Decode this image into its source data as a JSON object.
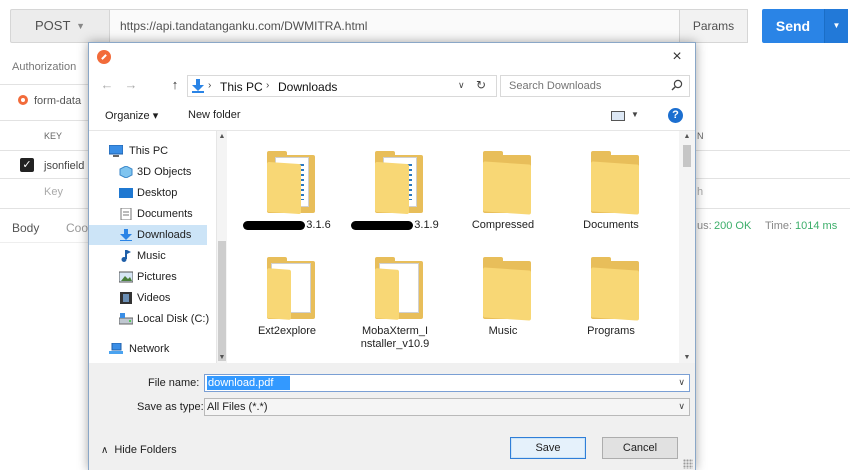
{
  "background_app": {
    "method": "POST",
    "url": "https://api.tandatanganku.com/DWMITRA.html",
    "params_label": "Params",
    "send_label": "Send",
    "section_tab": "Authorization",
    "body_type": "form-data",
    "table_header_key": "KEY",
    "table_header_partial": "N",
    "row_key": "jsonfield",
    "row_key_placeholder": "Key",
    "row_value_partial": "h",
    "response_tab_body": "Body",
    "response_tab_partial": "Coo",
    "status_label": "us:",
    "status_value": "200 OK",
    "time_label": "Time:",
    "time_value": "1014 ms"
  },
  "dialog": {
    "close_glyph": "×",
    "address": {
      "back_glyph": "←",
      "forward_glyph": "→",
      "up_glyph": "↑",
      "crumbs": [
        "This PC",
        "Downloads"
      ],
      "search_placeholder": "Search Downloads"
    },
    "toolbar": {
      "organize_label": "Organize ▾",
      "new_folder_label": "New folder",
      "help_glyph": "?"
    },
    "nav_items": [
      {
        "label": "This PC",
        "icon": "computer-icon"
      },
      {
        "label": "3D Objects",
        "icon": "cube-icon"
      },
      {
        "label": "Desktop",
        "icon": "desktop-icon"
      },
      {
        "label": "Documents",
        "icon": "document-icon"
      },
      {
        "label": "Downloads",
        "icon": "download-icon",
        "selected": true
      },
      {
        "label": "Music",
        "icon": "music-note-icon"
      },
      {
        "label": "Pictures",
        "icon": "picture-icon"
      },
      {
        "label": "Videos",
        "icon": "film-icon"
      },
      {
        "label": "Local Disk (C:)",
        "icon": "drive-icon"
      },
      {
        "label": "Network",
        "icon": "network-icon"
      }
    ],
    "files": [
      {
        "label": "3.1.6",
        "redacted": true,
        "type": "folder-with-files"
      },
      {
        "label": "3.1.9",
        "redacted": true,
        "type": "folder-with-files"
      },
      {
        "label": "Compressed",
        "type": "folder"
      },
      {
        "label": "Documents",
        "type": "folder"
      },
      {
        "label": "Ext2explore",
        "type": "folder-with-paper"
      },
      {
        "label": "MobaXterm_Installer_v10.9",
        "type": "folder-with-paper"
      },
      {
        "label": "Music",
        "type": "folder"
      },
      {
        "label": "Programs",
        "type": "folder"
      }
    ],
    "form": {
      "file_name_label": "File name:",
      "file_name_value": "download.pdf",
      "save_as_type_label": "Save as type:",
      "save_as_type_value": "All Files (*.*)",
      "hide_folders_label": "Hide Folders",
      "save_label": "Save",
      "cancel_label": "Cancel"
    }
  },
  "colors": {
    "send_blue": "#2a84e6",
    "status_green": "#3cae6a",
    "selection_blue": "#3399ff",
    "nav_selected": "#cce4f7",
    "folder_yellow": "#f8d775"
  }
}
